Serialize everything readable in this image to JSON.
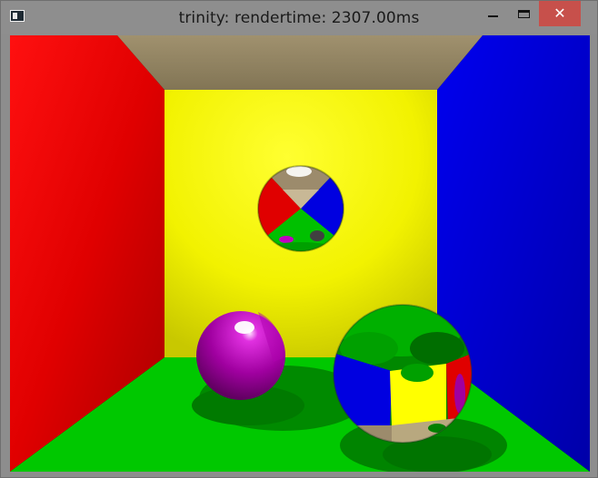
{
  "window": {
    "title": "trinity: rendertime: 2307.00ms",
    "controls": {
      "minimize": "minimize",
      "maximize": "maximize",
      "close": "✕"
    }
  },
  "scene": {
    "colors": {
      "left_wall": "#ff0000",
      "right_wall": "#0000ff",
      "back_wall": "#ffff00",
      "floor": "#00cc00",
      "ceiling": "#8f8166",
      "magenta_sphere": "#a000a0"
    },
    "objects": [
      "mirror-sphere-top",
      "magenta-sphere",
      "mirror-sphere-large"
    ]
  }
}
